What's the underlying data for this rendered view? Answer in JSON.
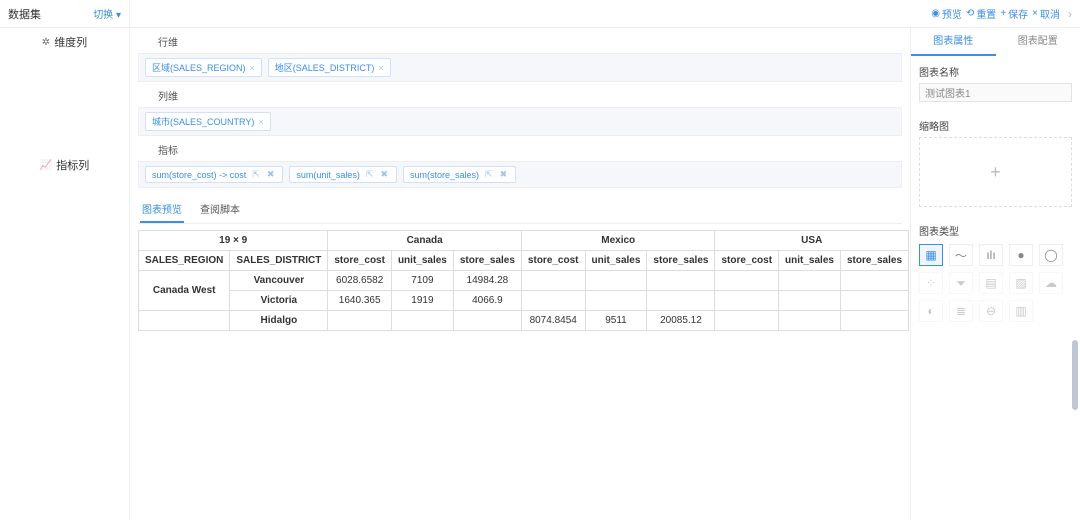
{
  "topbar": {
    "dataset_label": "数据集",
    "switch": "切换",
    "actions": {
      "preview": "预览",
      "reset": "重置",
      "save": "保存",
      "cancel": "取消"
    }
  },
  "sidebar": {
    "dim_section": "维度列",
    "metric_section": "指标列"
  },
  "zones": {
    "row_label": "行维",
    "rows": [
      {
        "label": "区域(SALES_REGION)"
      },
      {
        "label": "地区(SALES_DISTRICT)"
      }
    ],
    "col_label": "列维",
    "cols": [
      {
        "label": "城市(SALES_COUNTRY)"
      }
    ],
    "measure_label": "指标",
    "measures": [
      {
        "label": "sum(store_cost) -> cost"
      },
      {
        "label": "sum(unit_sales)"
      },
      {
        "label": "sum(store_sales)"
      }
    ]
  },
  "tabs": {
    "preview": "图表预览",
    "script": "查阅脚本",
    "active": 0
  },
  "pivot": {
    "dim_summary": "19 × 9",
    "row_dims": [
      "SALES_REGION",
      "SALES_DISTRICT"
    ],
    "col_groups": [
      "Canada",
      "Mexico",
      "USA"
    ],
    "value_cols": [
      "store_cost",
      "unit_sales",
      "store_sales"
    ],
    "rows": [
      {
        "region": "Canada West",
        "district": "Vancouver",
        "vals": [
          "6028.6582",
          "7109",
          "14984.28",
          "",
          "",
          "",
          "",
          "",
          ""
        ]
      },
      {
        "region": "",
        "district": "Victoria",
        "vals": [
          "1640.365",
          "1919",
          "4066.9",
          "",
          "",
          "",
          "",
          "",
          ""
        ]
      },
      {
        "region": "",
        "district": "Hidalgo",
        "vals": [
          "",
          "",
          "",
          "8074.8454",
          "9511",
          "20085.12",
          "",
          "",
          ""
        ]
      }
    ]
  },
  "rpanel": {
    "tabs": {
      "attrs": "图表属性",
      "config": "图表配置"
    },
    "name_label": "图表名称",
    "name_value": "测试图表1",
    "thumb_label": "缩略图",
    "type_label": "图表类型",
    "types": [
      {
        "g": "▦",
        "key": "table",
        "active": true
      },
      {
        "g": "〜",
        "key": "line"
      },
      {
        "g": "ılı",
        "key": "bar"
      },
      {
        "g": "●",
        "key": "scatter"
      },
      {
        "g": "◯",
        "key": "ring"
      },
      {
        "g": "⁘",
        "key": "bubble",
        "dim": true
      },
      {
        "g": "⏷",
        "key": "funnel",
        "dim": true
      },
      {
        "g": "▤",
        "key": "heat",
        "dim": true
      },
      {
        "g": "▨",
        "key": "area",
        "dim": true
      },
      {
        "g": "☁",
        "key": "cloud",
        "dim": true
      },
      {
        "g": "◐",
        "key": "gauge",
        "dim": true
      },
      {
        "g": "≣",
        "key": "grid2",
        "dim": true
      },
      {
        "g": "⊖",
        "key": "pie",
        "dim": true
      },
      {
        "g": "▥",
        "key": "stack",
        "dim": true
      }
    ]
  },
  "colors": {
    "accent": "#3a8ee6"
  }
}
